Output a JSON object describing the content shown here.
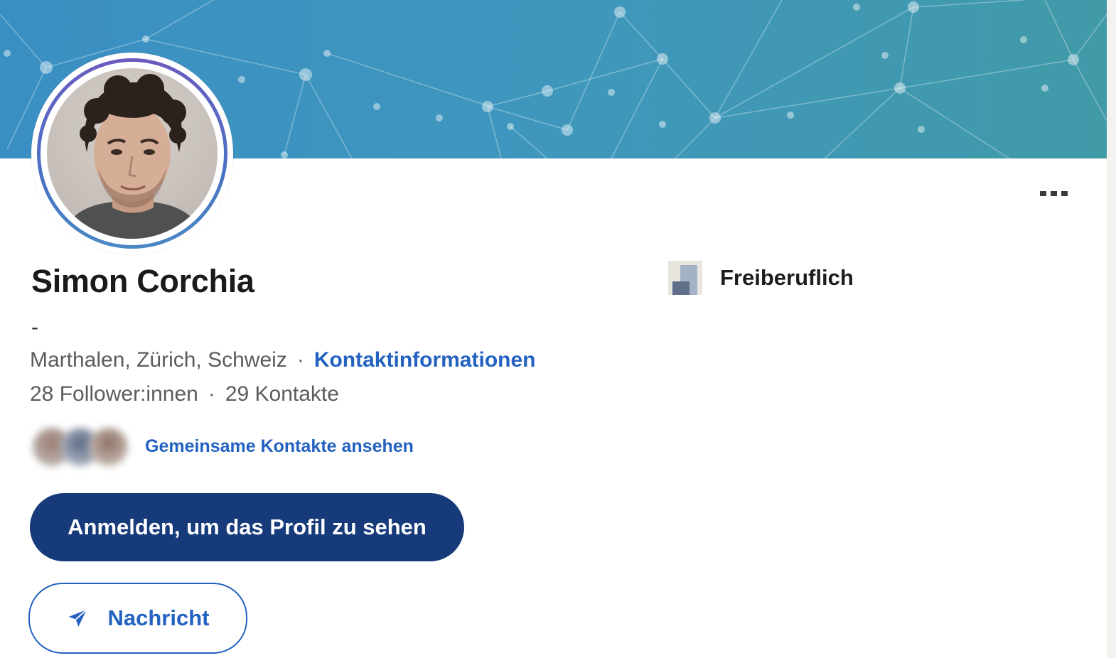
{
  "profile": {
    "name": "Simon Corchia",
    "headline": "-",
    "location": "Marthalen, Zürich, Schweiz",
    "separator": "·",
    "contact_info_link": "Kontaktinformationen",
    "followers": "28 Follower:innen",
    "connections": "29 Kontakte"
  },
  "mutual": {
    "link_label": "Gemeinsame Kontakte ansehen"
  },
  "actions": {
    "signin_label": "Anmelden, um das Profil zu sehen",
    "message_label": "Nachricht",
    "more_icon": "more-dots-icon",
    "message_icon": "paper-plane-icon"
  },
  "experience": {
    "company": "Freiberuflich"
  },
  "colors": {
    "link_blue": "#2362c0",
    "primary_button": "#173a7a",
    "banner": "#3f97bd"
  }
}
